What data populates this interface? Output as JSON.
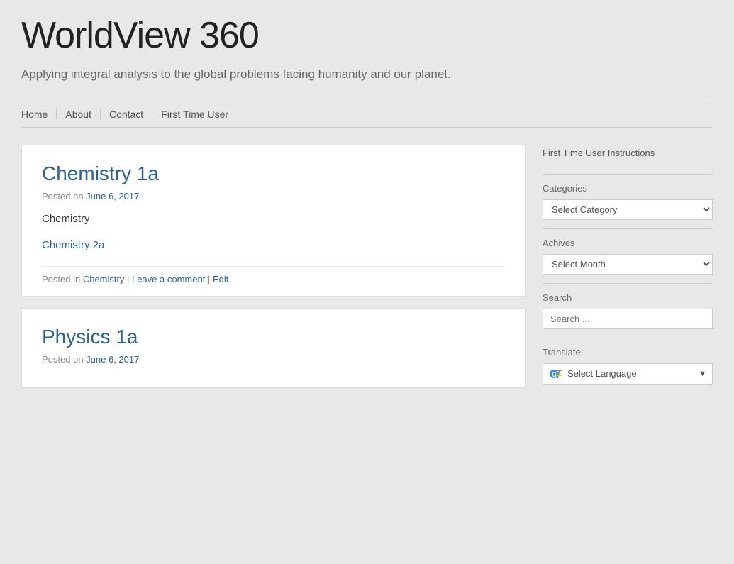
{
  "site": {
    "title": "WorldView 360",
    "description": "Applying integral analysis to the global problems facing humanity and our planet."
  },
  "nav": {
    "items": [
      {
        "label": "Home",
        "name": "home"
      },
      {
        "label": "About",
        "name": "about"
      },
      {
        "label": "Contact",
        "name": "contact"
      },
      {
        "label": "First Time User",
        "name": "first-time-user"
      }
    ]
  },
  "sidebar": {
    "first_time_user_link": "First Time User Instructions",
    "categories_label": "Categories",
    "categories_placeholder": "Select Category",
    "archives_label": "Achives",
    "archives_placeholder": "Select Month",
    "search_label": "Search",
    "search_placeholder": "Search ...",
    "translate_label": "Translate",
    "translate_select_text": "Select Language",
    "translate_icon_label": "google-translate-icon"
  },
  "posts": [
    {
      "title": "Chemistry 1a",
      "posted_on": "Posted on",
      "date": "June 6, 2017",
      "content": "Chemistry",
      "related_link_text": "Chemistry 2a",
      "footer_posted_in": "Posted in",
      "footer_category": "Chemistry",
      "footer_separator1": " | ",
      "footer_action1": "Leave a comment",
      "footer_separator2": " | ",
      "footer_action2": "Edit"
    },
    {
      "title": "Physics 1a",
      "posted_on": "Posted on",
      "date": "June 6, 2017",
      "content": "",
      "related_link_text": "",
      "footer_posted_in": "",
      "footer_category": "",
      "footer_separator1": "",
      "footer_action1": "",
      "footer_separator2": "",
      "footer_action2": ""
    }
  ]
}
